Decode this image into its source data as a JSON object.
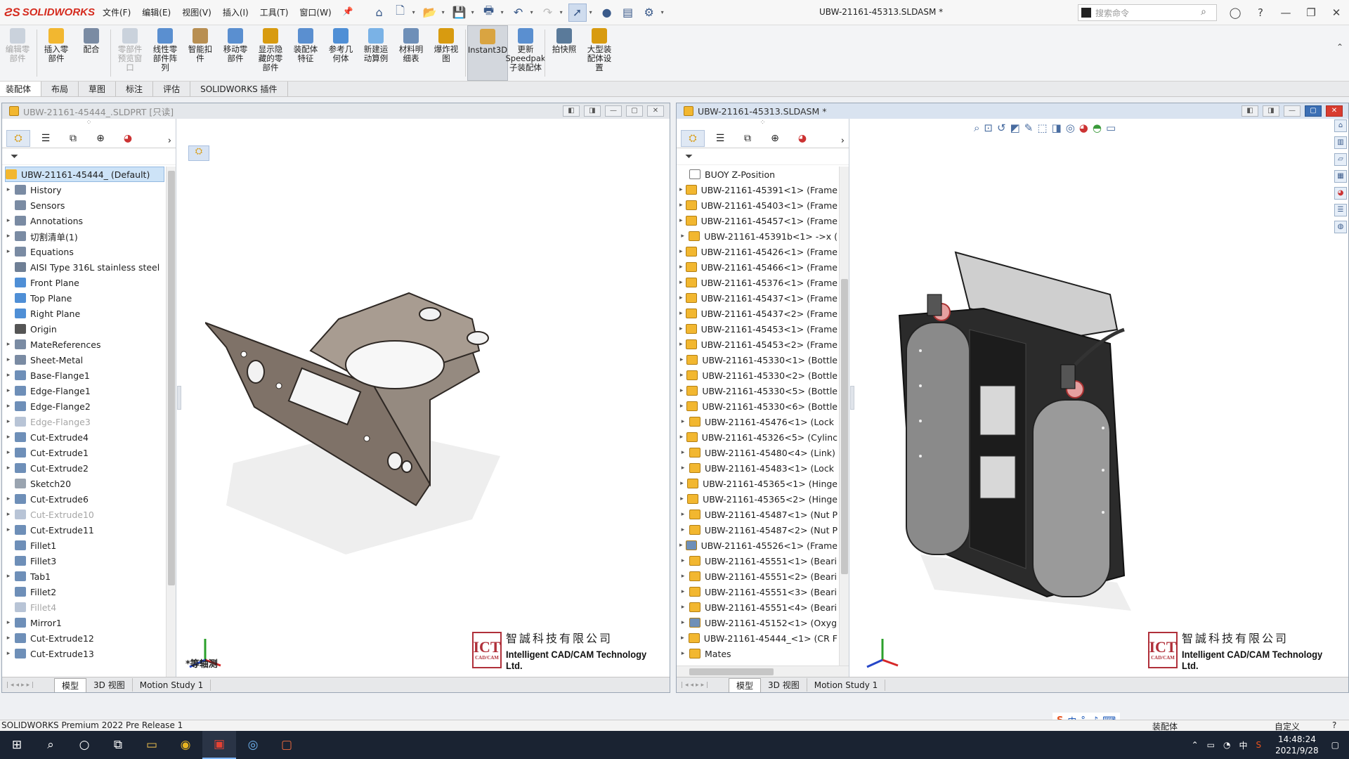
{
  "app": {
    "brand": "SOLIDWORKS",
    "menus": [
      "文件(F)",
      "编辑(E)",
      "视图(V)",
      "插入(I)",
      "工具(T)",
      "窗口(W)"
    ],
    "document_title": "UBW-21161-45313.SLDASM *",
    "search_placeholder": "搜索命令"
  },
  "command_manager": [
    {
      "label": "编辑零部件",
      "state": "disabled"
    },
    {
      "label": "插入零部件",
      "state": "normal"
    },
    {
      "label": "配合",
      "state": "normal"
    },
    {
      "label": "零部件预览窗口",
      "state": "disabled"
    },
    {
      "label": "线性零部件阵列",
      "state": "normal"
    },
    {
      "label": "智能扣件",
      "state": "normal"
    },
    {
      "label": "移动零部件",
      "state": "normal"
    },
    {
      "label": "显示隐藏的零部件",
      "state": "normal"
    },
    {
      "label": "装配体特征",
      "state": "normal"
    },
    {
      "label": "参考几何体",
      "state": "normal"
    },
    {
      "label": "新建运动算例",
      "state": "normal"
    },
    {
      "label": "材料明细表",
      "state": "normal"
    },
    {
      "label": "爆炸视图",
      "state": "normal"
    },
    {
      "label": "Instant3D",
      "state": "active"
    },
    {
      "label": "更新Speedpak子装配体",
      "state": "normal"
    },
    {
      "label": "拍快照",
      "state": "normal"
    },
    {
      "label": "大型装配体设置",
      "state": "normal"
    }
  ],
  "tabs": [
    "装配体",
    "布局",
    "草图",
    "标注",
    "评估",
    "SOLIDWORKS 插件"
  ],
  "left_doc": {
    "title": "UBW-21161-45444_.SLDPRT [只读]",
    "tree_root": "UBW-21161-45444_ (Default)",
    "tree": [
      {
        "label": "History",
        "expand": true,
        "dim": false,
        "color": "#7a8ba3"
      },
      {
        "label": "Sensors",
        "expand": false,
        "dim": false,
        "color": "#7a8ba3"
      },
      {
        "label": "Annotations",
        "expand": true,
        "dim": false,
        "color": "#7a8ba3"
      },
      {
        "label": "切割清单(1)",
        "expand": true,
        "dim": false,
        "color": "#7a8ba3"
      },
      {
        "label": "Equations",
        "expand": true,
        "dim": false,
        "color": "#7a8ba3"
      },
      {
        "label": "AISI Type 316L stainless steel",
        "expand": false,
        "dim": false,
        "color": "#6f7f95"
      },
      {
        "label": "Front Plane",
        "expand": false,
        "dim": false,
        "color": "#4f8fd6"
      },
      {
        "label": "Top Plane",
        "expand": false,
        "dim": false,
        "color": "#4f8fd6"
      },
      {
        "label": "Right Plane",
        "expand": false,
        "dim": false,
        "color": "#4f8fd6"
      },
      {
        "label": "Origin",
        "expand": false,
        "dim": false,
        "color": "#555555"
      },
      {
        "label": "MateReferences",
        "expand": true,
        "dim": false,
        "color": "#7a8ba3"
      },
      {
        "label": "Sheet-Metal",
        "expand": true,
        "dim": false,
        "color": "#7a8ba3"
      },
      {
        "label": "Base-Flange1",
        "expand": true,
        "dim": false,
        "color": "#6e8fb8"
      },
      {
        "label": "Edge-Flange1",
        "expand": true,
        "dim": false,
        "color": "#6e8fb8"
      },
      {
        "label": "Edge-Flange2",
        "expand": true,
        "dim": false,
        "color": "#6e8fb8"
      },
      {
        "label": "Edge-Flange3",
        "expand": true,
        "dim": true,
        "color": "#b8c4d6"
      },
      {
        "label": "Cut-Extrude4",
        "expand": true,
        "dim": false,
        "color": "#6e8fb8"
      },
      {
        "label": "Cut-Extrude1",
        "expand": true,
        "dim": false,
        "color": "#6e8fb8"
      },
      {
        "label": "Cut-Extrude2",
        "expand": true,
        "dim": false,
        "color": "#6e8fb8"
      },
      {
        "label": "Sketch20",
        "expand": false,
        "dim": false,
        "color": "#9aa4b0"
      },
      {
        "label": "Cut-Extrude6",
        "expand": true,
        "dim": false,
        "color": "#6e8fb8"
      },
      {
        "label": "Cut-Extrude10",
        "expand": true,
        "dim": true,
        "color": "#b8c4d6"
      },
      {
        "label": "Cut-Extrude11",
        "expand": true,
        "dim": false,
        "color": "#6e8fb8"
      },
      {
        "label": "Fillet1",
        "expand": false,
        "dim": false,
        "color": "#6e8fb8"
      },
      {
        "label": "Fillet3",
        "expand": false,
        "dim": false,
        "color": "#6e8fb8"
      },
      {
        "label": "Tab1",
        "expand": true,
        "dim": false,
        "color": "#6e8fb8"
      },
      {
        "label": "Fillet2",
        "expand": false,
        "dim": false,
        "color": "#6e8fb8"
      },
      {
        "label": "Fillet4",
        "expand": false,
        "dim": true,
        "color": "#b8c4d6"
      },
      {
        "label": "Mirror1",
        "expand": true,
        "dim": false,
        "color": "#6e8fb8"
      },
      {
        "label": "Cut-Extrude12",
        "expand": true,
        "dim": false,
        "color": "#6e8fb8"
      },
      {
        "label": "Cut-Extrude13",
        "expand": true,
        "dim": false,
        "color": "#6e8fb8"
      }
    ],
    "view_label": "*等轴测",
    "bottom_tabs": [
      "模型",
      "3D 视图",
      "Motion Study 1"
    ]
  },
  "right_doc": {
    "title": "UBW-21161-45313.SLDASM *",
    "tree": [
      "BUOY Z-Position",
      "UBW-21161-45391<1> (Frame",
      "UBW-21161-45403<1> (Frame",
      "UBW-21161-45457<1> (Frame",
      "UBW-21161-45391b<1> ->x (",
      "UBW-21161-45426<1> (Frame",
      "UBW-21161-45466<1> (Frame",
      "UBW-21161-45376<1> (Frame",
      "UBW-21161-45437<1> (Frame",
      "UBW-21161-45437<2> (Frame",
      "UBW-21161-45453<1> (Frame",
      "UBW-21161-45453<2> (Frame",
      "UBW-21161-45330<1> (Bottle",
      "UBW-21161-45330<2> (Bottle",
      "UBW-21161-45330<5> (Bottle",
      "UBW-21161-45330<6> (Bottle",
      "UBW-21161-45476<1> (Lock",
      "UBW-21161-45326<5> (Cylinc",
      "UBW-21161-45480<4> (Link)",
      "UBW-21161-45483<1> (Lock",
      "UBW-21161-45365<1> (Hinge",
      "UBW-21161-45365<2> (Hinge",
      "UBW-21161-45487<1> (Nut P",
      "UBW-21161-45487<2> (Nut P",
      "UBW-21161-45526<1> (Frame",
      "UBW-21161-45551<1> (Beari",
      "UBW-21161-45551<2> (Beari",
      "UBW-21161-45551<3> (Beari",
      "UBW-21161-45551<4> (Beari",
      "UBW-21161-45152<1> (Oxyg",
      "UBW-21161-45444_<1> (CR F",
      "Mates"
    ],
    "bottom_tabs": [
      "模型",
      "3D 视图",
      "Motion Study 1"
    ]
  },
  "watermark": {
    "logo": "ICT",
    "logo_sub": "CAD/CAM",
    "cn": "智誠科技有限公司",
    "en": "Intelligent CAD/CAM Technology Ltd."
  },
  "status": {
    "left": "SOLIDWORKS Premium 2022 Pre Release 1",
    "mode": "装配体",
    "custom": "自定义"
  },
  "ime": [
    "中",
    "°,",
    "🎤",
    "⌨"
  ],
  "taskbar": {
    "time": "14:48:24",
    "date": "2021/9/28",
    "lang": "中"
  }
}
